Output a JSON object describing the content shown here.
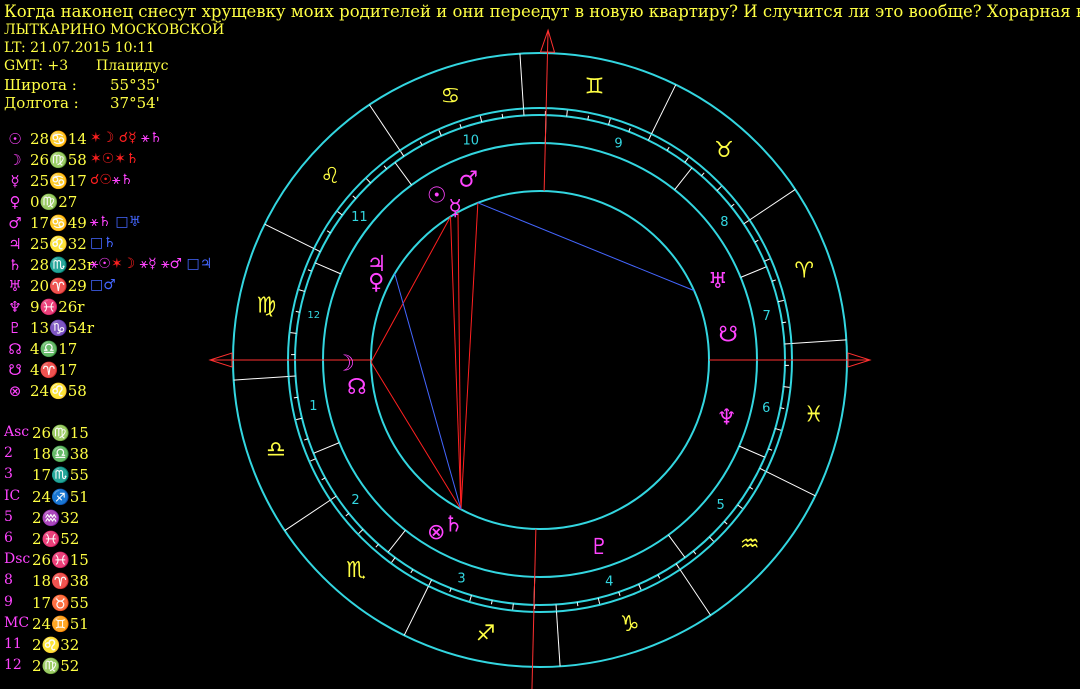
{
  "header": {
    "title": "Когда наконец снесут хрущевку моих родителей и они переедут в новую квартиру? И случится ли это вообще? Хорарная карта",
    "place": "ЛЫТКАРИНО МОСКОВСКОЙ",
    "lt": "LT: 21.07.2015  10:11",
    "gmt": "GMT: +3",
    "system": "Плацидус",
    "lat_label": "Широта :",
    "lat_value": "55°35'",
    "lon_label": "Долгота :",
    "lon_value": "37°54'"
  },
  "planets": [
    {
      "glyph": "☉",
      "pos": "28♋14",
      "aspects": [
        {
          "t": "✶☽",
          "c": "#ff2020"
        },
        {
          "t": " ☌☿",
          "c": "#ff2020"
        },
        {
          "t": " ⚹♄",
          "c": "#ff44ff"
        }
      ]
    },
    {
      "glyph": "☽",
      "pos": "26♍58",
      "aspects": [
        {
          "t": "✶☉",
          "c": "#ff2020"
        },
        {
          "t": "✶♄",
          "c": "#ff2020"
        }
      ]
    },
    {
      "glyph": "☿",
      "pos": "25♋17",
      "aspects": [
        {
          "t": "☌☉",
          "c": "#ff2020"
        },
        {
          "t": "⚹♄",
          "c": "#ff44ff"
        }
      ]
    },
    {
      "glyph": "♀",
      "pos": "0♍27",
      "aspects": []
    },
    {
      "glyph": "♂",
      "pos": "17♋49",
      "aspects": [
        {
          "t": "⚹♄",
          "c": "#ff44ff"
        },
        {
          "t": " □♅",
          "c": "#4466ff"
        }
      ]
    },
    {
      "glyph": "♃",
      "pos": "25♌32",
      "aspects": [
        {
          "t": "□♄",
          "c": "#4466ff"
        }
      ]
    },
    {
      "glyph": "♄",
      "pos": "28♏23r",
      "aspects": [
        {
          "t": "⚹☉",
          "c": "#ff44ff"
        },
        {
          "t": "✶☽",
          "c": "#ff2020"
        },
        {
          "t": " ⚹☿",
          "c": "#ff44ff"
        },
        {
          "t": " ⚹♂",
          "c": "#ff44ff"
        },
        {
          "t": " □♃",
          "c": "#4466ff"
        }
      ]
    },
    {
      "glyph": "♅",
      "pos": "20♈29",
      "aspects": [
        {
          "t": "□♂",
          "c": "#4466ff"
        }
      ]
    },
    {
      "glyph": "♆",
      "pos": "9♓26r",
      "aspects": []
    },
    {
      "glyph": "♇",
      "pos": "13♑54r",
      "aspects": []
    },
    {
      "glyph": "☊",
      "pos": "4♎17",
      "aspects": []
    },
    {
      "glyph": "☋",
      "pos": "4♈17",
      "aspects": []
    },
    {
      "glyph": "⊗",
      "pos": "24♌58",
      "aspects": []
    }
  ],
  "cusps": [
    {
      "label": "Asc",
      "pos": "26♍15"
    },
    {
      "label": "2",
      "pos": "18♎38"
    },
    {
      "label": "3",
      "pos": "17♏55"
    },
    {
      "label": "IC",
      "pos": "24♐51"
    },
    {
      "label": "5",
      "pos": "2♒32"
    },
    {
      "label": "6",
      "pos": "2♓52"
    },
    {
      "label": "Dsc",
      "pos": "26♓15"
    },
    {
      "label": "8",
      "pos": "18♈38"
    },
    {
      "label": "9",
      "pos": "17♉55"
    },
    {
      "label": "MC",
      "pos": "24♊51"
    },
    {
      "label": "11",
      "pos": "2♌32"
    },
    {
      "label": "12",
      "pos": "2♍52"
    }
  ],
  "chart": {
    "zodiac": [
      {
        "glyph": "♋",
        "lon": 105
      },
      {
        "glyph": "♊",
        "lon": 75
      },
      {
        "glyph": "♉",
        "lon": 45
      },
      {
        "glyph": "♈",
        "lon": 15
      },
      {
        "glyph": "♓",
        "lon": 345
      },
      {
        "glyph": "♒",
        "lon": 315
      },
      {
        "glyph": "♑",
        "lon": 285
      },
      {
        "glyph": "♐",
        "lon": 255
      },
      {
        "glyph": "♏",
        "lon": 225
      },
      {
        "glyph": "♎",
        "lon": 195
      },
      {
        "glyph": "♍",
        "lon": 165
      },
      {
        "glyph": "♌",
        "lon": 135
      }
    ],
    "house_cusps": [
      176.25,
      198.63,
      227.92,
      264.85,
      302.53,
      332.87,
      356.25,
      18.63,
      47.92,
      84.85,
      122.53,
      152.87
    ],
    "house_numbers": [
      "1",
      "2",
      "3",
      "4",
      "5",
      "6",
      "7",
      "8",
      "9",
      "10",
      "11",
      "12"
    ],
    "planets": [
      {
        "glyph": "☉",
        "lon": 118.23,
        "r": 195,
        "c": "#ff44ff"
      },
      {
        "glyph": "☽",
        "lon": 176.97,
        "r": 195,
        "c": "#ff44ff"
      },
      {
        "glyph": "☿",
        "lon": 115.28,
        "r": 175,
        "c": "#ff44ff"
      },
      {
        "glyph": "♀",
        "lon": 150.45,
        "r": 182,
        "c": "#ff44ff"
      },
      {
        "glyph": "♂",
        "lon": 107.82,
        "r": 195,
        "c": "#ff44ff"
      },
      {
        "glyph": "♃",
        "lon": 145.53,
        "r": 190,
        "c": "#ff44ff"
      },
      {
        "glyph": "♄",
        "lon": 238.38,
        "r": 185,
        "c": "#ff44ff"
      },
      {
        "glyph": "♅",
        "lon": 20.48,
        "r": 195,
        "c": "#ff44ff"
      },
      {
        "glyph": "♆",
        "lon": 339.43,
        "r": 195,
        "c": "#ff44ff"
      },
      {
        "glyph": "♇",
        "lon": 283.9,
        "r": 195,
        "c": "#ff44ff"
      },
      {
        "glyph": "☊",
        "lon": 184.28,
        "r": 185,
        "c": "#ff44ff"
      },
      {
        "glyph": "☋",
        "lon": 4.28,
        "r": 190,
        "c": "#ff44ff"
      },
      {
        "glyph": "⊗",
        "lon": 235.0,
        "r": 200,
        "c": "#ff44ff"
      }
    ],
    "aspect_lines": [
      {
        "a": 118.23,
        "b": 176.97,
        "c": "#ff2020"
      },
      {
        "a": 176.97,
        "b": 238.38,
        "c": "#ff2020"
      },
      {
        "a": 118.23,
        "b": 238.38,
        "c": "#ff2020"
      },
      {
        "a": 115.28,
        "b": 238.38,
        "c": "#ff2020"
      },
      {
        "a": 107.82,
        "b": 238.38,
        "c": "#ff2020"
      },
      {
        "a": 145.53,
        "b": 238.38,
        "c": "#4466ff"
      },
      {
        "a": 107.82,
        "b": 20.48,
        "c": "#4466ff"
      }
    ]
  }
}
